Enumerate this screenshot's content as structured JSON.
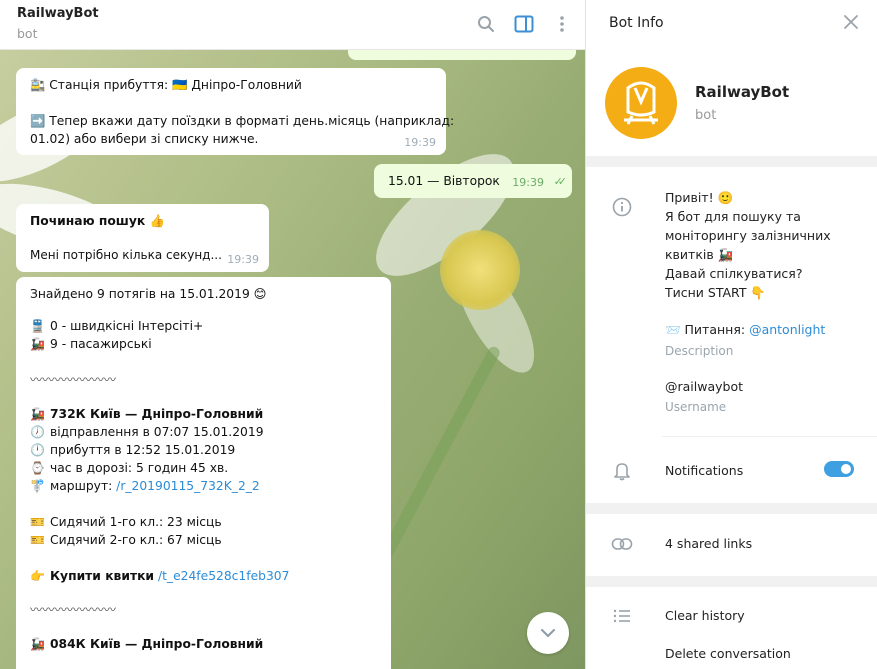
{
  "chat": {
    "title": "RailwayBot",
    "subtitle": "bot",
    "messages": {
      "station": {
        "line1": "🚉 Станція прибуття: 🇺🇦 Дніпро-Головний",
        "line2": "➡️ Тепер вкажи дату поїздки в форматі день.місяць (наприклад:",
        "line3": "01.02) або вибери зі списку нижче.",
        "time": "19:39"
      },
      "date_reply": {
        "text": "15.01 — Вівторок",
        "time": "19:39"
      },
      "searching": {
        "line1": "Починаю пошук 👍",
        "line2": "Мені потрібно кілька секунд...",
        "time": "19:39"
      },
      "results": {
        "found": "Знайдено 9 потягів на 15.01.2019 😊",
        "type1": "0 - швидкісні Інтерсіті+",
        "type2": "9 - пасажирські",
        "wave": "〰〰〰〰〰〰〰",
        "train1_route": "732К Київ — Дніпро-Головний",
        "departure": "відправлення в 07:07 15.01.2019",
        "arrival": "прибуття в 12:52 15.01.2019",
        "duration": "час в дорозі: 5 годин 45 хв.",
        "route_label": "маршрут: ",
        "route_link": "/r_20190115_732K_2_2",
        "seat1": "Сидячий 1-го кл.: 23 місць",
        "seat2": "Сидячий 2-го кл.: 67 місць",
        "buy_label": "Купити квитки",
        "buy_link": "/t_e24fe528c1feb307",
        "wave2": "〰〰〰〰〰〰〰",
        "train2_route": "084К Київ — Дніпро-Головний"
      }
    }
  },
  "info": {
    "title": "Bot Info",
    "name": "RailwayBot",
    "subtitle": "bot",
    "about_lines": [
      "Привіт! 🙂",
      "Я бот для пошуку та",
      "моніторингу залізничних",
      "квитків 🚂",
      "Давай спілкуватися?",
      "Тисни START 👇"
    ],
    "contact_prefix": "📨 Питання: ",
    "contact_link": "@antonlight",
    "description_caption": "Description",
    "username": "@railwaybot",
    "username_caption": "Username",
    "notifications": "Notifications",
    "notifications_on": true,
    "shared_links": "4 shared links",
    "clear_history": "Clear history",
    "delete_conversation": "Delete conversation"
  },
  "colors": {
    "accent": "#3ea0e0",
    "avatar": "#f4ad15",
    "outgoing": "#effdde"
  }
}
